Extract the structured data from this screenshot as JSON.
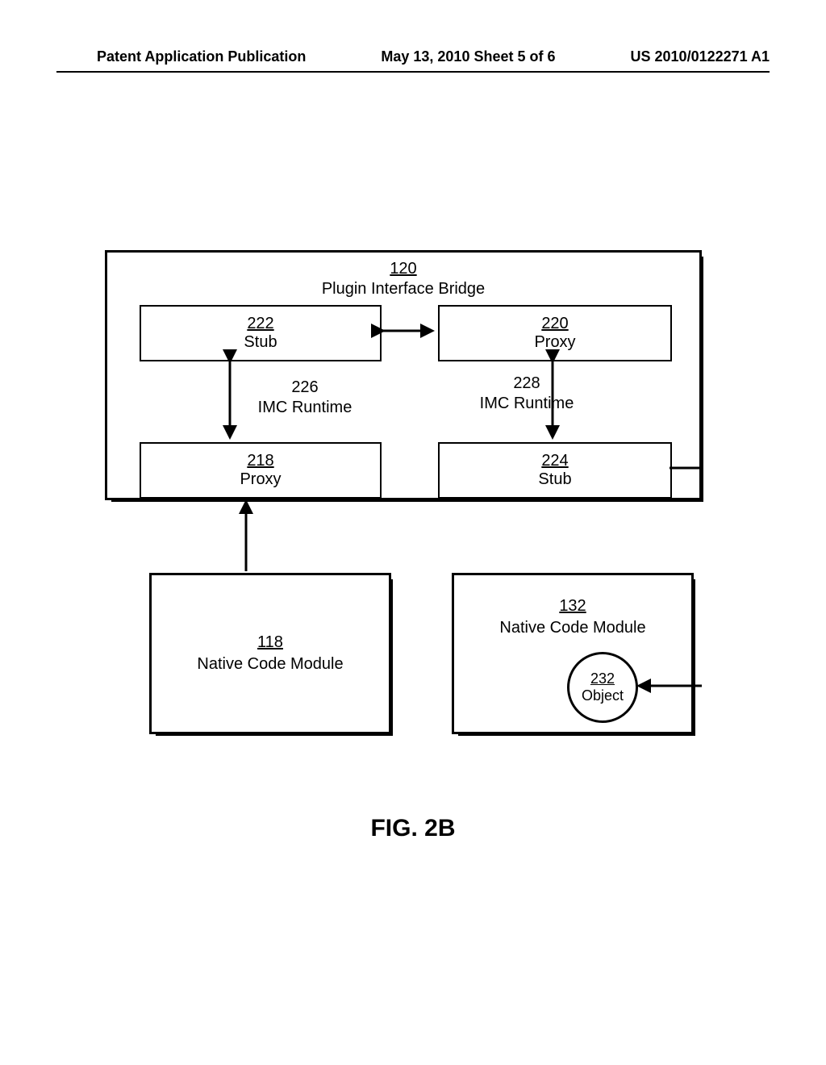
{
  "header": {
    "left": "Patent Application Publication",
    "center": "May 13, 2010  Sheet 5 of 6",
    "right": "US 2010/0122271 A1"
  },
  "bridge": {
    "num": "120",
    "label": "Plugin Interface Bridge"
  },
  "boxes": {
    "b222": {
      "num": "222",
      "label": "Stub"
    },
    "b220": {
      "num": "220",
      "label": "Proxy"
    },
    "b218": {
      "num": "218",
      "label": "Proxy"
    },
    "b224": {
      "num": "224",
      "label": "Stub"
    }
  },
  "imc": {
    "i226": {
      "num": "226",
      "label": "IMC Runtime"
    },
    "i228": {
      "num": "228",
      "label": "IMC Runtime"
    }
  },
  "ncm118": {
    "num": "118",
    "label": "Native Code Module"
  },
  "ncm132": {
    "num": "132",
    "label": "Native Code Module"
  },
  "object": {
    "num": "232",
    "label": "Object"
  },
  "fig": "FIG. 2B"
}
